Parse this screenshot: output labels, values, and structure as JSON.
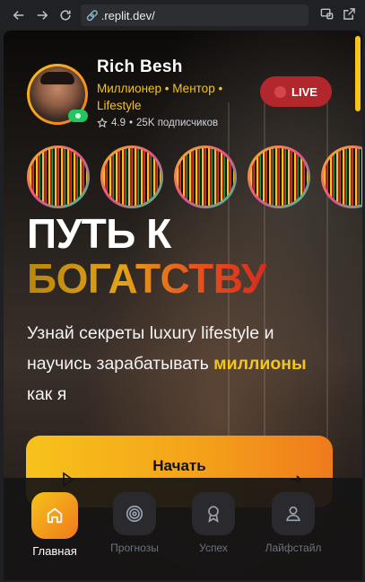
{
  "browser": {
    "url": ".replit.dev/"
  },
  "profile": {
    "name": "Rich Besh",
    "tagline": "Миллионер • Ментор • Lifestyle",
    "rating": "4.9",
    "subscribers": "25K подписчиков",
    "live_label": "LIVE"
  },
  "stories_count": 5,
  "hero": {
    "line1": "ПУТЬ К",
    "line2": "БОГАТСТВУ",
    "sub_part1": "Узнай секреты luxury lifestyle и научись зарабатывать ",
    "sub_highlight": "миллионы",
    "sub_part2": " как я"
  },
  "cta": {
    "label": "Начать"
  },
  "bottom_nav": {
    "items": [
      {
        "label": "Главная",
        "icon": "home-icon",
        "active": true
      },
      {
        "label": "Прогнозы",
        "icon": "target-icon",
        "active": false
      },
      {
        "label": "Успех",
        "icon": "award-icon",
        "active": false
      },
      {
        "label": "Лайфстайл",
        "icon": "user-icon",
        "active": false
      }
    ]
  },
  "colors": {
    "accent": "#f5c518",
    "accent_orange": "#ef7a1c",
    "live_red": "#b2272c",
    "online_green": "#22c55e"
  }
}
